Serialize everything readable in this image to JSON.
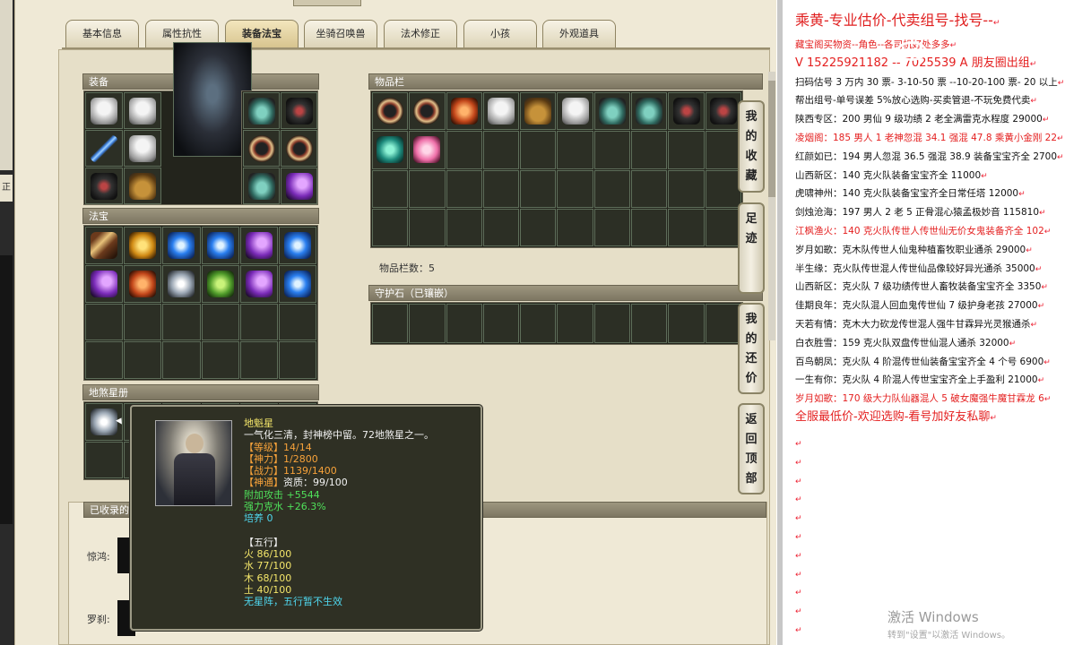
{
  "tabs": [
    {
      "label": "基本信息"
    },
    {
      "label": "属性抗性"
    },
    {
      "label": "装备法宝"
    },
    {
      "label": "坐骑召唤兽"
    },
    {
      "label": "法术修正"
    },
    {
      "label": "小孩"
    },
    {
      "label": "外观道具"
    }
  ],
  "left_strip": {
    "label": "正"
  },
  "panels": {
    "equipment": "装备",
    "treasure": "法宝",
    "star_book": "地煞星册",
    "collected": "已收录的",
    "inventory": "物品栏",
    "guard_stone": "守护石（已镶嵌）"
  },
  "inventory_count": "物品栏数：5",
  "collected_labels": [
    "惊鸿:",
    "罗刹:"
  ],
  "side_buttons": [
    {
      "label": "我的收藏"
    },
    {
      "label": "足迹"
    },
    {
      "label": "我的还价"
    },
    {
      "label": "返回顶部"
    }
  ],
  "tooltip": {
    "name": "地魁星",
    "desc": "一气化三清，封神榜中留。72地煞星之一。",
    "level": "【等级】14/14",
    "shenli": "【神力】1/2800",
    "zhanli": "【战力】1139/1400",
    "shentong_label": "【神通】",
    "shentong_value": "资质：99/100",
    "extra_attack": "附加攻击 +5544",
    "resist": "强力克水 +26.3%",
    "cultivate": "培养 0",
    "wuxing_title": "【五行】",
    "fire": "火 86/100",
    "water": "水 77/100",
    "wood": "木 68/100",
    "earth": "土 40/100",
    "note": "无星阵，五行暂不生效"
  },
  "doc": {
    "lines": [
      {
        "text": "乘黄-专业估价-代卖组号-找号--",
        "style": "title"
      },
      {
        "text": "藏宝阁买物资--角色--各司机好处多多",
        "style": "red"
      },
      {
        "text": "V 15225921182 -- 7025539 A 朋友圈出组",
        "style": "red big"
      },
      {
        "text": "扫码估号 3 万内 30 票- 3-10-50 票  --10-20-100 票- 20 以上",
        "style": ""
      },
      {
        "text": "帮出组号-单号误差 5%放心选购-买卖管退-不玩免费代卖",
        "style": ""
      },
      {
        "text": "陕西专区：200 男仙 9 级功绩 2 老全满雷克水程度 29000",
        "style": ""
      },
      {
        "text": "凌烟阁：185 男人 1 老神忽混 34.1 强混 47.8 乘黄小金刚 22",
        "style": "red"
      },
      {
        "text": "红颜如已：194 男人忽混 36.5 强混 38.9 装备宝宝齐全 2700",
        "style": ""
      },
      {
        "text": "山西新区：140 克火队装备宝宝齐全 11000",
        "style": ""
      },
      {
        "text": "虎啸神州：140 克火队装备宝宝齐全日常任塔 12000",
        "style": ""
      },
      {
        "text": "剑烛沧海：197 男人 2 老 5 正骨混心猿孟极妙音 115810",
        "style": ""
      },
      {
        "text": "江枫渔火：140 克火队传世人传世仙无价女鬼装备齐全 102",
        "style": "red"
      },
      {
        "text": "岁月如歌：克木队传世人仙鬼种植畜牧职业通杀 29000",
        "style": ""
      },
      {
        "text": "半生缘：克火队传世混人传世仙品像较好异光通杀 35000",
        "style": ""
      },
      {
        "text": "山西新区：克火队 7 级功绩传世人畜牧装备宝宝齐全 3350",
        "style": ""
      },
      {
        "text": "佳期良年：克火队混人回血鬼传世仙 7 级护身老孩 27000",
        "style": ""
      },
      {
        "text": "天若有情：克木大力砍龙传世混人强牛甘霖异光灵猴通杀",
        "style": ""
      },
      {
        "text": "白衣胜雪：159 克火队双盘传世仙混人通杀 32000",
        "style": ""
      },
      {
        "text": "百鸟朝凤：克火队 4 阶混传世仙装备宝宝齐全 4 个号 6900",
        "style": ""
      },
      {
        "text": "一生有你：克火队 4 阶混人传世宝宝齐全上手盈利 21000",
        "style": ""
      },
      {
        "text": "岁月如歌：170 级大力队仙器混人 5 破女魔强牛魔甘霖龙 6",
        "style": "red"
      },
      {
        "text": "全服最低价-欢迎选购-看号加好友私聊",
        "style": "red big"
      }
    ],
    "return_mark": "↵"
  },
  "watermark": {
    "title": "激活 Windows",
    "sub": "转到\"设置\"以激活 Windows。"
  }
}
